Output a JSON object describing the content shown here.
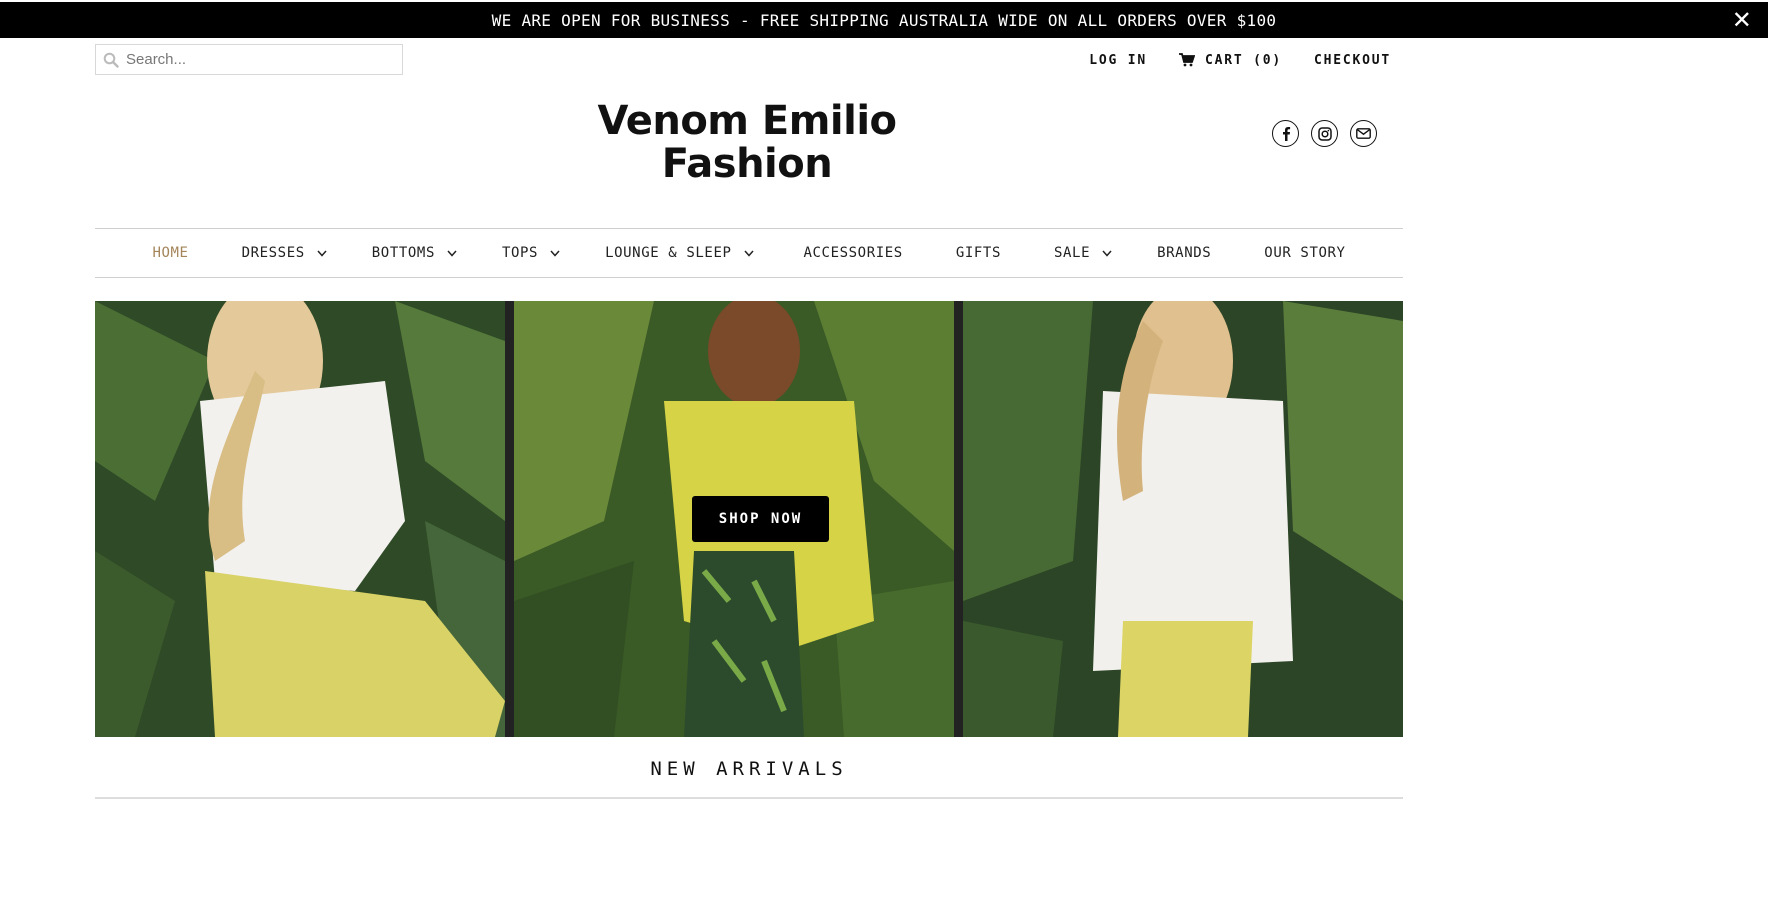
{
  "announcement": {
    "text": "WE ARE OPEN FOR BUSINESS - FREE SHIPPING AUSTRALIA WIDE ON ALL ORDERS OVER $100",
    "close_icon": "close-icon"
  },
  "search": {
    "placeholder": "Search...",
    "icon": "search-icon"
  },
  "account": {
    "login_label": "LOG IN",
    "cart_label": "CART (0)",
    "checkout_label": "CHECKOUT",
    "cart_icon": "cart-icon"
  },
  "logo": {
    "line1": "Venom Emilio",
    "line2": "Fashion"
  },
  "social": [
    "facebook-icon",
    "instagram-icon",
    "email-icon"
  ],
  "nav": {
    "items": [
      {
        "label": "HOME",
        "dropdown": false,
        "active": true
      },
      {
        "label": "DRESSES",
        "dropdown": true,
        "active": false
      },
      {
        "label": "BOTTOMS",
        "dropdown": true,
        "active": false
      },
      {
        "label": "TOPS",
        "dropdown": true,
        "active": false
      },
      {
        "label": "LOUNGE & SLEEP",
        "dropdown": true,
        "active": false
      },
      {
        "label": "ACCESSORIES",
        "dropdown": false,
        "active": false
      },
      {
        "label": "GIFTS",
        "dropdown": false,
        "active": false
      },
      {
        "label": "SALE",
        "dropdown": true,
        "active": false
      },
      {
        "label": "BRANDS",
        "dropdown": false,
        "active": false
      },
      {
        "label": "OUR STORY",
        "dropdown": false,
        "active": false
      }
    ],
    "active_color": "#a4855a"
  },
  "hero": {
    "button_label": "SHOP NOW"
  },
  "section": {
    "title": "NEW ARRIVALS"
  },
  "colors": {
    "announcement_bg": "#000000",
    "accent": "#a4855a",
    "button_bg": "#000000"
  }
}
